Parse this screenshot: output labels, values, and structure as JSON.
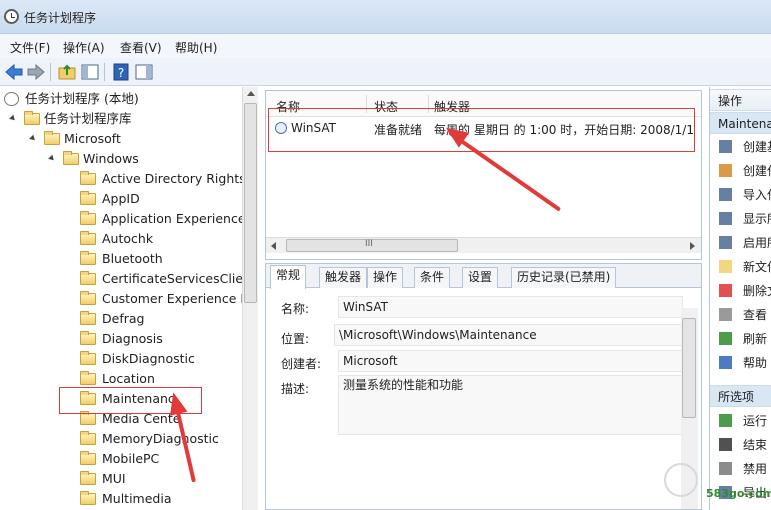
{
  "window": {
    "title": "任务计划程序"
  },
  "menu": [
    "文件(F)",
    "操作(A)",
    "查看(V)",
    "帮助(H)"
  ],
  "tree": {
    "root": "任务计划程序 (本地)",
    "library": "任务计划程序库",
    "microsoft": "Microsoft",
    "windows": "Windows",
    "folders": [
      "Active Directory Rights I",
      "AppID",
      "Application Experience",
      "Autochk",
      "Bluetooth",
      "CertificateServicesClient",
      "Customer Experience In",
      "Defrag",
      "Diagnosis",
      "DiskDiagnostic",
      "Location",
      "Maintenanc",
      "Media Cente",
      "MemoryDiagnostic",
      "MobilePC",
      "MUI",
      "Multimedia"
    ]
  },
  "task_list": {
    "columns": [
      "名称",
      "状态",
      "触发器"
    ],
    "rows": [
      {
        "name": "WinSAT",
        "status": "准备就绪",
        "trigger": "每周的 星期日 的 1:00 时，开始日期: 2008/1/1"
      }
    ],
    "hscroll_label": "III"
  },
  "details": {
    "tabs": [
      "常规",
      "触发器",
      "操作",
      "条件",
      "设置",
      "历史记录(已禁用)"
    ],
    "fields": {
      "name_label": "名称:",
      "name_value": "WinSAT",
      "location_label": "位置:",
      "location_value": "\\Microsoft\\Windows\\Maintenance",
      "author_label": "创建者:",
      "author_value": "Microsoft",
      "desc_label": "描述:",
      "desc_value": "测量系统的性能和功能"
    }
  },
  "actions": {
    "header": "操作",
    "section1": "Maintena",
    "items1": [
      "创建基",
      "创建任",
      "导入任",
      "显示所",
      "启用所",
      "新文件",
      "删除文",
      "查看",
      "刷新",
      "帮助"
    ],
    "section2": "所选项",
    "items2": [
      "运行",
      "结束",
      "禁用",
      "导出..."
    ]
  },
  "watermark": "583go.com"
}
